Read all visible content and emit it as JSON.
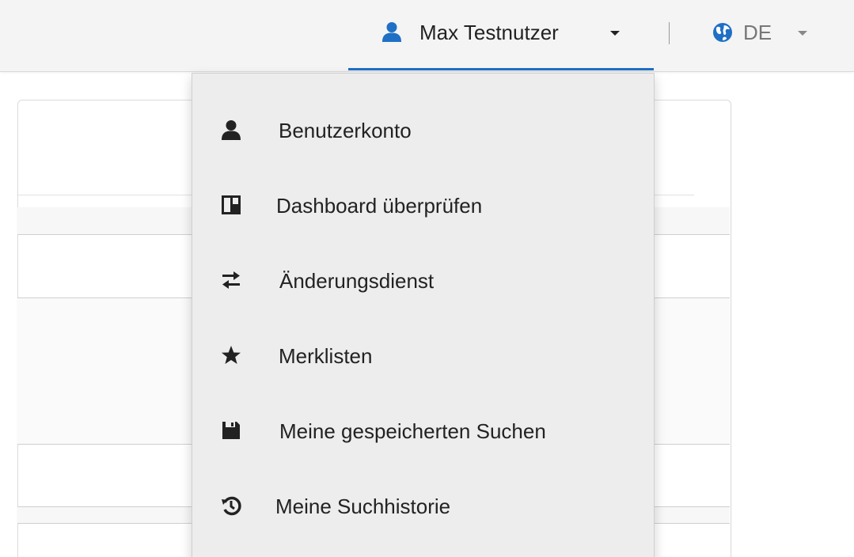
{
  "navbar": {
    "user_name": "Max Testnutzer",
    "language": "DE",
    "active_underline_color": "#1f6fc5",
    "user_icon": "user-icon",
    "language_icon": "globe-icon"
  },
  "user_menu": {
    "items": [
      {
        "label": "Benutzerkonto",
        "icon": "user-icon"
      },
      {
        "label": "Dashboard überprüfen",
        "icon": "dashboard-icon"
      },
      {
        "label": "Änderungsdienst",
        "icon": "exchange-arrows-icon"
      },
      {
        "label": "Merklisten",
        "icon": "star-icon"
      },
      {
        "label": "Meine gespeicherten Suchen",
        "icon": "floppy-disk-icon"
      },
      {
        "label": "Meine Suchhistorie",
        "icon": "history-icon"
      }
    ]
  }
}
